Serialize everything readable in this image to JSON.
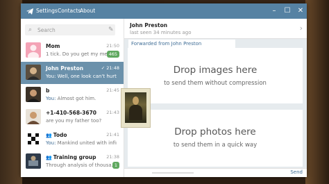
{
  "window": {
    "menu": [
      "Settings",
      "Contacts",
      "About"
    ]
  },
  "search": {
    "placeholder": "Search"
  },
  "chats": [
    {
      "name": "Mom",
      "preview_you": "",
      "preview": "1 tick. Do you get my me...",
      "time": "21:50",
      "badge": "465",
      "group": false,
      "active": false
    },
    {
      "name": "John Preston",
      "preview_you": "You:",
      "preview": "Well, one look can't hurt. c...",
      "time": "21:48",
      "badge": "",
      "group": false,
      "active": true
    },
    {
      "name": "b",
      "preview_you": "You:",
      "preview": "Almost got him.",
      "time": "21:45",
      "badge": "",
      "group": false,
      "active": false
    },
    {
      "name": "+1-410-568-3670",
      "preview_you": "",
      "preview": "are you my father too?",
      "time": "21:43",
      "badge": "",
      "group": false,
      "active": false
    },
    {
      "name": "Todo",
      "preview_you": "You:",
      "preview": "Mankind united with infini...",
      "time": "21:41",
      "badge": "",
      "group": true,
      "active": false
    },
    {
      "name": "Training group",
      "preview_you": "",
      "preview": "Through analysis of thousa...",
      "time": "21:38",
      "badge": "1",
      "group": true,
      "active": false
    }
  ],
  "conversation": {
    "name": "John Preston",
    "status": "last seen 34 minutes ago",
    "forwarded": "Forwarded from John Preston"
  },
  "drop_zones": {
    "images_title": "Drop images here",
    "images_sub": "to send them without compression",
    "photos_title": "Drop photos here",
    "photos_sub": "to send them in a quick way"
  },
  "footer": {
    "send_label": "Send"
  },
  "colors": {
    "titlebar": "#5682a3",
    "active_chat": "#6b91ab",
    "badge": "#5fa85f",
    "link": "#3f6d96"
  }
}
